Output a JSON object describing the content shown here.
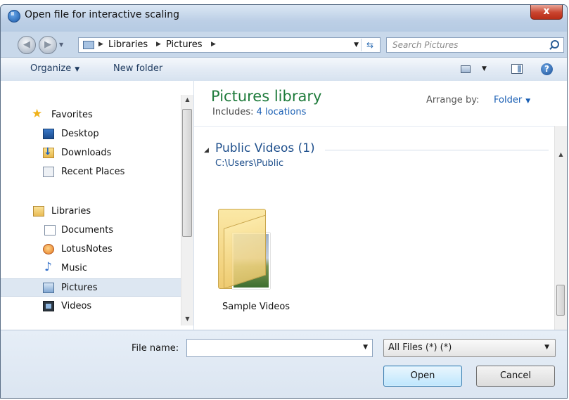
{
  "window": {
    "title": "Open file for interactive scaling",
    "close_symbol": "x"
  },
  "navigation": {
    "back_icon": "back-arrow-icon",
    "forward_icon": "forward-arrow-icon",
    "breadcrumbs": [
      "Libraries",
      "Pictures"
    ],
    "search_placeholder": "Search Pictures"
  },
  "toolbar": {
    "organize_label": "Organize",
    "new_folder_label": "New folder",
    "help_symbol": "?"
  },
  "sidebar": {
    "items": [
      {
        "label": "Favorites",
        "icon": "star-icon"
      },
      {
        "label": "Desktop",
        "icon": "desktop-icon"
      },
      {
        "label": "Downloads",
        "icon": "downloads-icon"
      },
      {
        "label": "Recent Places",
        "icon": "recent-places-icon"
      },
      {
        "label": "Libraries",
        "icon": "libraries-icon"
      },
      {
        "label": "Documents",
        "icon": "documents-icon"
      },
      {
        "label": "LotusNotes",
        "icon": "lotusnotes-icon"
      },
      {
        "label": "Music",
        "icon": "music-icon"
      },
      {
        "label": "Pictures",
        "icon": "pictures-icon",
        "selected": true
      },
      {
        "label": "Videos",
        "icon": "videos-icon"
      }
    ]
  },
  "library": {
    "title": "Pictures library",
    "includes_label": "Includes:",
    "includes_link": "4 locations",
    "arrange_label": "Arrange by:",
    "arrange_value": "Folder"
  },
  "content": {
    "group_title": "Public Videos (1)",
    "group_path": "C:\\Users\\Public",
    "items": [
      {
        "label": "Sample Videos",
        "icon": "folder-icon"
      }
    ]
  },
  "footer": {
    "filename_label": "File name:",
    "filename_value": "",
    "filetype_value": "All Files (*) (*)",
    "open_label": "Open",
    "cancel_label": "Cancel"
  }
}
